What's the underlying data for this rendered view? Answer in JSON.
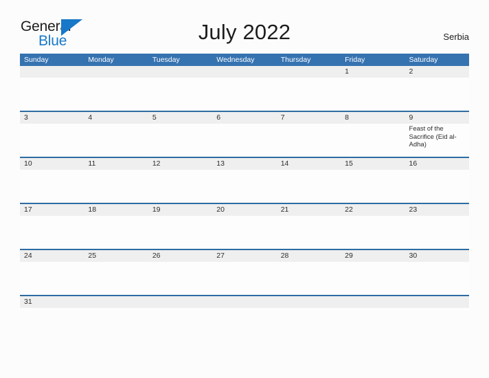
{
  "brand": {
    "name_part1": "General",
    "name_part2": "Blue",
    "flag_icon": "triangle-flag-icon",
    "color_dark": "#1c1c1c",
    "color_blue": "#1878c8"
  },
  "header": {
    "title": "July 2022",
    "region": "Serbia"
  },
  "theme": {
    "header_bar": "#3572b0",
    "row_divider": "#2d6ca2",
    "date_band": "#efefef",
    "page_background": "#fcfcfc"
  },
  "calendar": {
    "weekdays": [
      "Sunday",
      "Monday",
      "Tuesday",
      "Wednesday",
      "Thursday",
      "Friday",
      "Saturday"
    ],
    "weeks": [
      {
        "days": [
          {
            "date": "",
            "events": []
          },
          {
            "date": "",
            "events": []
          },
          {
            "date": "",
            "events": []
          },
          {
            "date": "",
            "events": []
          },
          {
            "date": "",
            "events": []
          },
          {
            "date": "1",
            "events": []
          },
          {
            "date": "2",
            "events": []
          }
        ]
      },
      {
        "days": [
          {
            "date": "3",
            "events": []
          },
          {
            "date": "4",
            "events": []
          },
          {
            "date": "5",
            "events": []
          },
          {
            "date": "6",
            "events": []
          },
          {
            "date": "7",
            "events": []
          },
          {
            "date": "8",
            "events": []
          },
          {
            "date": "9",
            "events": [
              "Feast of the Sacrifice (Eid al-Adha)"
            ]
          }
        ]
      },
      {
        "days": [
          {
            "date": "10",
            "events": []
          },
          {
            "date": "11",
            "events": []
          },
          {
            "date": "12",
            "events": []
          },
          {
            "date": "13",
            "events": []
          },
          {
            "date": "14",
            "events": []
          },
          {
            "date": "15",
            "events": []
          },
          {
            "date": "16",
            "events": []
          }
        ]
      },
      {
        "days": [
          {
            "date": "17",
            "events": []
          },
          {
            "date": "18",
            "events": []
          },
          {
            "date": "19",
            "events": []
          },
          {
            "date": "20",
            "events": []
          },
          {
            "date": "21",
            "events": []
          },
          {
            "date": "22",
            "events": []
          },
          {
            "date": "23",
            "events": []
          }
        ]
      },
      {
        "days": [
          {
            "date": "24",
            "events": []
          },
          {
            "date": "25",
            "events": []
          },
          {
            "date": "26",
            "events": []
          },
          {
            "date": "27",
            "events": []
          },
          {
            "date": "28",
            "events": []
          },
          {
            "date": "29",
            "events": []
          },
          {
            "date": "30",
            "events": []
          }
        ]
      },
      {
        "days": [
          {
            "date": "31",
            "events": []
          },
          {
            "date": "",
            "events": []
          },
          {
            "date": "",
            "events": []
          },
          {
            "date": "",
            "events": []
          },
          {
            "date": "",
            "events": []
          },
          {
            "date": "",
            "events": []
          },
          {
            "date": "",
            "events": []
          }
        ]
      }
    ]
  }
}
